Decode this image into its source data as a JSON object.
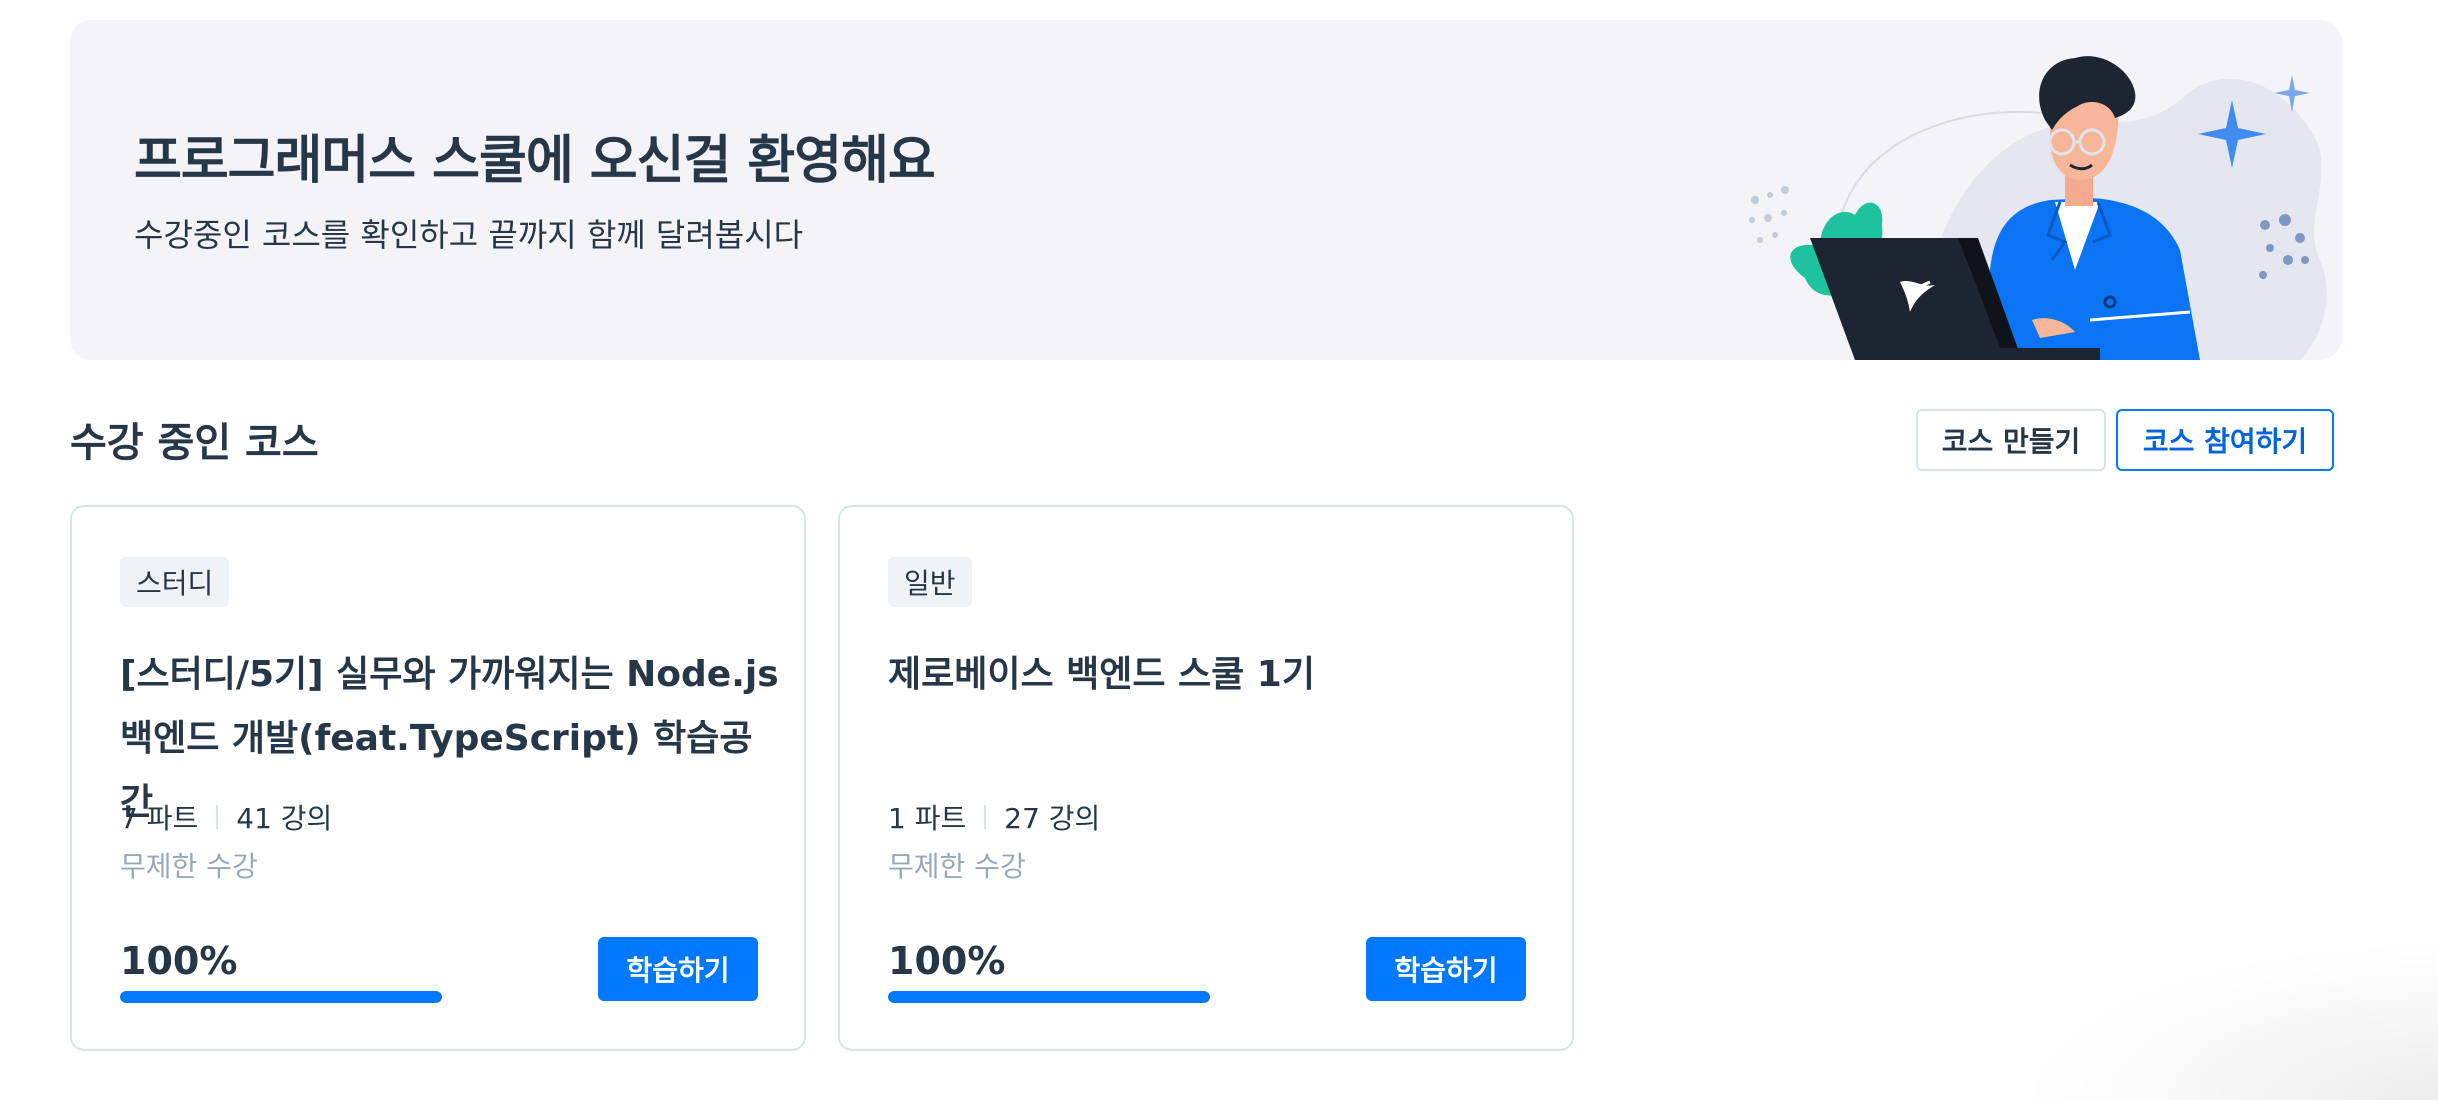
{
  "banner": {
    "title": "프로그래머스 스쿨에 오신걸 환영해요",
    "subtitle": "수강중인 코스를 확인하고 끝까지 함께 달려봅시다"
  },
  "section": {
    "title": "수강 중인 코스",
    "create_label": "코스 만들기",
    "join_label": "코스 참여하기"
  },
  "courses": [
    {
      "tag": "스터디",
      "title": "[스터디/5기] 실무와 가까워지는 Node.js 백엔드 개발(feat.TypeScript) 학습공간",
      "parts": "7 파트",
      "lectures": "41 강의",
      "term": "무제한 수강",
      "progress_label": "100%",
      "progress": 1.0,
      "action_label": "학습하기"
    },
    {
      "tag": "일반",
      "title": "제로베이스 백엔드 스쿨 1기",
      "parts": "1 파트",
      "lectures": "27 강의",
      "term": "무제한 수강",
      "progress_label": "100%",
      "progress": 1.0,
      "action_label": "학습하기"
    }
  ],
  "colors": {
    "accent": "#0078ff",
    "text": "#263747",
    "muted": "#98a8b9",
    "banner_bg": "#f3f3f8"
  }
}
